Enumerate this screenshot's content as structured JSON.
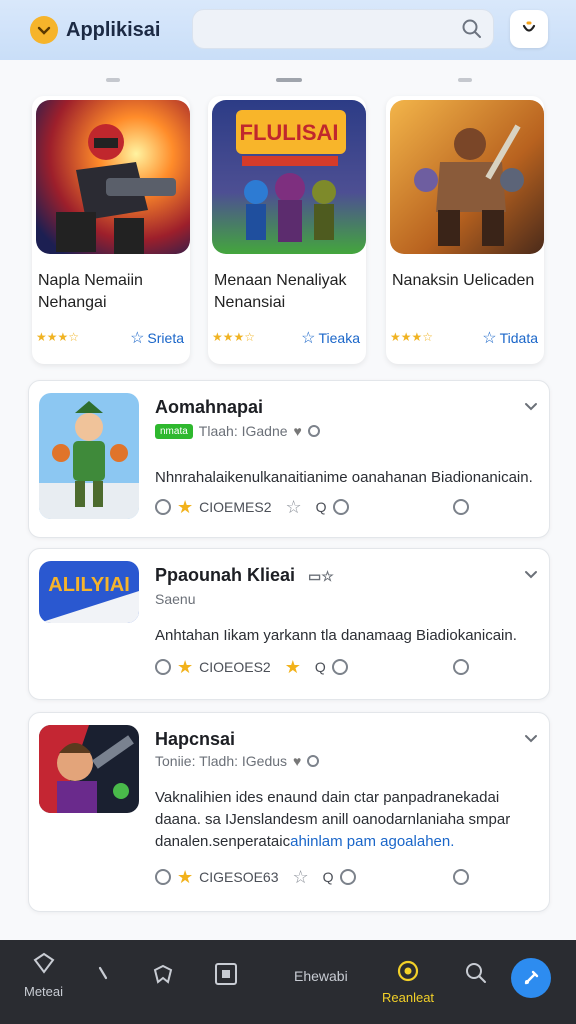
{
  "header": {
    "app_title": "Applikisai",
    "search_placeholder": "",
    "accent": "#f6b42b"
  },
  "featured": [
    {
      "name": "Napla Nemaiin Nehangai",
      "rating": 3,
      "status": "Srieta"
    },
    {
      "name": "Menaan Nenaliyak Nenansiai",
      "rating": 3,
      "status": "Tieaka",
      "thumb_text": "FLULISAI"
    },
    {
      "name": "Nanaksin Uelicaden",
      "rating": 3,
      "status": "Tidata"
    }
  ],
  "list": [
    {
      "title": "Aomahnapai",
      "badge": "nmata",
      "meta": "Tlaah: IGadne",
      "desc": "Nhnrahalaikenulkanaitianime oanahanan Biadionanicain.",
      "action_count": "CIOEMES2"
    },
    {
      "title": "Ppaounah Klieai",
      "meta": "Saenu",
      "desc": "Anhtahan Iikam yarkann tla danamaag Biadiokanicain.",
      "action_count": "CIOEOES2",
      "thumb_text": "ALILYIAI"
    },
    {
      "title": "Hapcnsai",
      "meta": "Toniie: Tladh: IGedus",
      "desc_plain": "Vaknalihien ides enaund dain ctar panpadranekadai daana. sa IJenslandesm anill oanodarnlaniaha smpar danalen.senperataic",
      "desc_link": "ahinlam pam agoalahen.",
      "action_count": "CIGESOE63"
    }
  ],
  "nav": {
    "item1": "Meteai",
    "item4": "",
    "item5": "Ehewabi",
    "item6": "Reanleat"
  }
}
